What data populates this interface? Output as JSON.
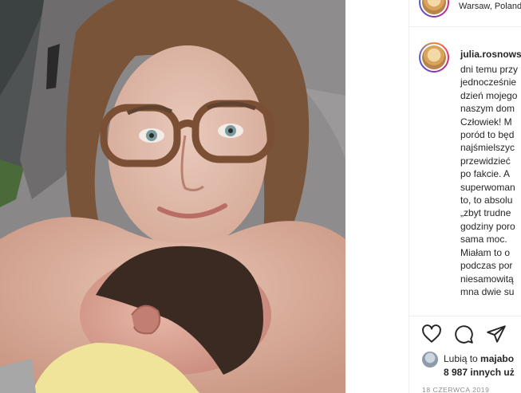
{
  "post": {
    "location": "Warsaw, Poland",
    "username": "julia.rosnowska",
    "caption_lines": [
      "dni temu przy",
      "jednocześnie",
      "dzień mojego",
      "naszym dom",
      "Człowiek! M",
      "poród to będ",
      "najśmielszyc",
      "przewidzieć",
      "po fakcie. A",
      "superwoman",
      "to, to absolu",
      "„zbyt trudne",
      "godziny poro",
      "sama moc.",
      "Miałam to o",
      "podczas por",
      "niesamowitą",
      "mna dwie su"
    ],
    "likes_prefix": "Lubią to",
    "likes_user": "majabo",
    "likes_count": "8 987 innych uż",
    "date": "18 CZERWCA 2019"
  },
  "icons": {
    "heart": "heart-icon",
    "comment": "comment-icon",
    "share": "share-icon"
  },
  "colors": {
    "story_ring": [
      "#f58529",
      "#dd2a7b",
      "#8134af",
      "#515bd4"
    ],
    "border": "#efefef",
    "secondary_text": "#8e8e8e"
  }
}
